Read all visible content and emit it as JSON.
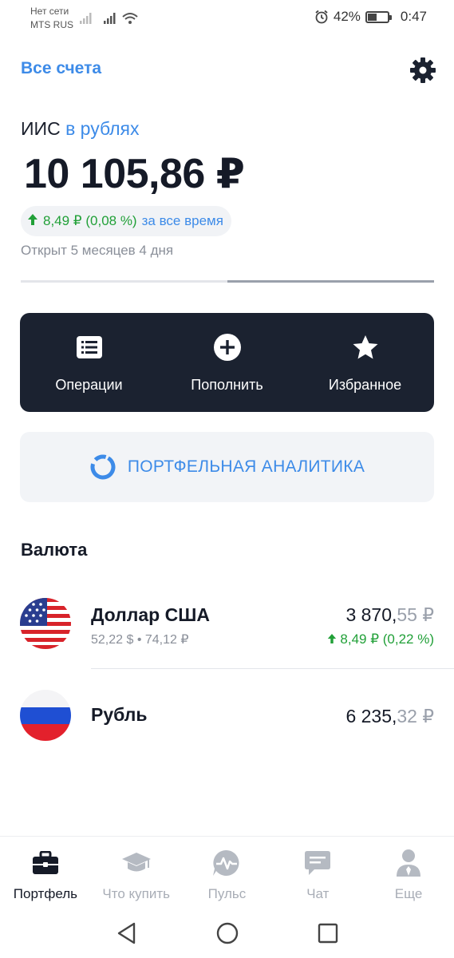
{
  "status_bar": {
    "carrier_line1": "Нет сети",
    "carrier_line2": "MTS RUS",
    "battery": "42%",
    "time": "0:47"
  },
  "header": {
    "all_accounts": "Все счета",
    "settings_icon": "gear-icon"
  },
  "account": {
    "type": "ИИС",
    "currency": "в рублях",
    "balance": "10 105,86 ₽",
    "gain": "8,49 ₽ (0,08 %)",
    "gain_period": "за все время",
    "opened": "Открыт 5 месяцев 4 дня",
    "progress_fraction": 0.5
  },
  "actions": [
    {
      "label": "Операции",
      "icon": "list-icon"
    },
    {
      "label": "Пополнить",
      "icon": "plus-circle-icon"
    },
    {
      "label": "Избранное",
      "icon": "star-icon"
    }
  ],
  "analytics": {
    "label": "ПОРТФЕЛЬНАЯ АНАЛИТИКА",
    "icon": "donut-chart-icon"
  },
  "currency_section": {
    "title": "Валюта",
    "items": [
      {
        "name": "Доллар США",
        "sub": "52,22 $ • 74,12 ₽",
        "amount_int": "3 870,",
        "amount_dec": "55 ₽",
        "change": "8,49 ₽ (0,22 %)",
        "flag": "us-flag-icon"
      },
      {
        "name": "Рубль",
        "amount_int": "6 235,",
        "amount_dec": "32 ₽",
        "flag": "ru-flag-icon"
      }
    ]
  },
  "bottom_nav": [
    {
      "label": "Портфель",
      "icon": "briefcase-icon",
      "active": true
    },
    {
      "label": "Что купить",
      "icon": "graduation-cap-icon",
      "active": false
    },
    {
      "label": "Пульс",
      "icon": "pulse-icon",
      "active": false
    },
    {
      "label": "Чат",
      "icon": "chat-icon",
      "active": false
    },
    {
      "label": "Еще",
      "icon": "user-icon",
      "active": false
    }
  ],
  "colors": {
    "accent": "#3d8be8",
    "positive": "#21a038",
    "dark_card": "#1b2230",
    "text_primary": "#151a27",
    "text_secondary": "#8a8f99"
  }
}
